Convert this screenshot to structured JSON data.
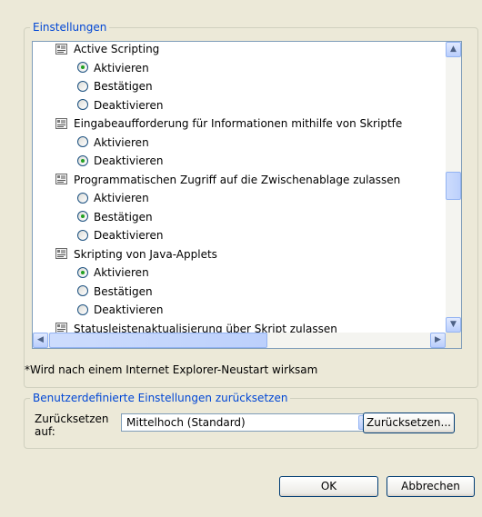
{
  "settings_group": {
    "title": "Einstellungen",
    "items": [
      {
        "type": "category",
        "label": "Active Scripting"
      },
      {
        "type": "option",
        "label": "Aktivieren",
        "selected": true
      },
      {
        "type": "option",
        "label": "Bestätigen",
        "selected": false
      },
      {
        "type": "option",
        "label": "Deaktivieren",
        "selected": false
      },
      {
        "type": "category",
        "label": "Eingabeaufforderung für Informationen mithilfe von Skriptfe"
      },
      {
        "type": "option",
        "label": "Aktivieren",
        "selected": false
      },
      {
        "type": "option",
        "label": "Deaktivieren",
        "selected": true
      },
      {
        "type": "category",
        "label": "Programmatischen Zugriff auf die Zwischenablage zulassen"
      },
      {
        "type": "option",
        "label": "Aktivieren",
        "selected": false
      },
      {
        "type": "option",
        "label": "Bestätigen",
        "selected": true
      },
      {
        "type": "option",
        "label": "Deaktivieren",
        "selected": false
      },
      {
        "type": "category",
        "label": "Skripting von Java-Applets"
      },
      {
        "type": "option",
        "label": "Aktivieren",
        "selected": true
      },
      {
        "type": "option",
        "label": "Bestätigen",
        "selected": false
      },
      {
        "type": "option",
        "label": "Deaktivieren",
        "selected": false
      },
      {
        "type": "category",
        "label": "Statusleistenaktualisierung über Skript zulassen"
      }
    ],
    "restart_note": "*Wird nach einem Internet Explorer-Neustart wirksam"
  },
  "reset_group": {
    "title": "Benutzerdefinierte Einstellungen zurücksetzen",
    "label": "Zurücksetzen auf:",
    "selected_level": "Mittelhoch (Standard)",
    "reset_button": "Zurücksetzen..."
  },
  "dialog_buttons": {
    "ok": "OK",
    "cancel": "Abbrechen"
  },
  "colors": {
    "accent": "#0046d5",
    "radio_selected": "#21a121",
    "background": "#ece9d8"
  }
}
